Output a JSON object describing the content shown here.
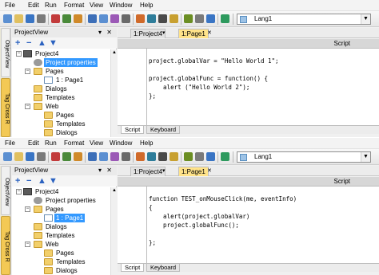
{
  "colors": {
    "selection": "#3399ff",
    "active_tab": "#ffe38a",
    "vertical_tab_active": "#f3c955"
  },
  "menu": [
    "File",
    "Edit",
    "Run",
    "Format",
    "View",
    "Window",
    "Help"
  ],
  "toolbar": {
    "language_combo_value": "Lang1"
  },
  "vertical_tabs": [
    "ObjectView",
    "Tag Cross R"
  ],
  "project_view": {
    "title": "ProjectView",
    "controls": "▾ ✕",
    "toolbar_icons": [
      "add-icon",
      "remove-icon",
      "move-up-icon",
      "move-down-icon"
    ]
  },
  "panels": [
    {
      "tree": [
        {
          "label": "Project4",
          "icon": "project-icon",
          "expander": "−"
        },
        {
          "label": "Project properties",
          "icon": "gear-icon",
          "selected": true
        },
        {
          "label": "Pages",
          "icon": "folder-icon",
          "expander": "−"
        },
        {
          "label": "1 : Page1",
          "icon": "page-icon"
        },
        {
          "label": "Dialogs",
          "icon": "folder-icon"
        },
        {
          "label": "Templates",
          "icon": "folder-icon"
        },
        {
          "label": "Web",
          "icon": "folder-icon",
          "expander": "−"
        },
        {
          "label": "Pages",
          "icon": "folder-icon"
        },
        {
          "label": "Templates",
          "icon": "folder-icon"
        },
        {
          "label": "Dialogs",
          "icon": "folder-icon"
        }
      ],
      "doc_tabs": [
        {
          "label": "1:Project4",
          "active": false
        },
        {
          "label": "1:Page1",
          "active": true
        }
      ],
      "script_header": "Script",
      "code": [
        "project.globalVar = \"Hello World 1\";",
        "",
        "project.globalFunc = function() {",
        "    alert (\"Hello World 2\");",
        "};"
      ],
      "bottom_tabs": [
        "Script",
        "Keyboard"
      ]
    },
    {
      "tree": [
        {
          "label": "Project4",
          "icon": "project-icon",
          "expander": "−"
        },
        {
          "label": "Project properties",
          "icon": "gear-icon"
        },
        {
          "label": "Pages",
          "icon": "folder-icon",
          "expander": "−"
        },
        {
          "label": "1 : Page1",
          "icon": "page-icon",
          "selected": true
        },
        {
          "label": "Dialogs",
          "icon": "folder-icon"
        },
        {
          "label": "Templates",
          "icon": "folder-icon"
        },
        {
          "label": "Web",
          "icon": "folder-icon",
          "expander": "−"
        },
        {
          "label": "Pages",
          "icon": "folder-icon"
        },
        {
          "label": "Templates",
          "icon": "folder-icon"
        },
        {
          "label": "Dialogs",
          "icon": "folder-icon"
        }
      ],
      "doc_tabs": [
        {
          "label": "1:Project4",
          "active": false
        },
        {
          "label": "1:Page1",
          "active": true
        }
      ],
      "script_header": "Script",
      "code": [
        "function TEST_onMouseClick(me, eventInfo)",
        "{",
        "    alert(project.globalVar)",
        "    project.globalFunc();",
        "",
        "};"
      ],
      "bottom_tabs": [
        "Script",
        "Keyboard"
      ]
    }
  ]
}
